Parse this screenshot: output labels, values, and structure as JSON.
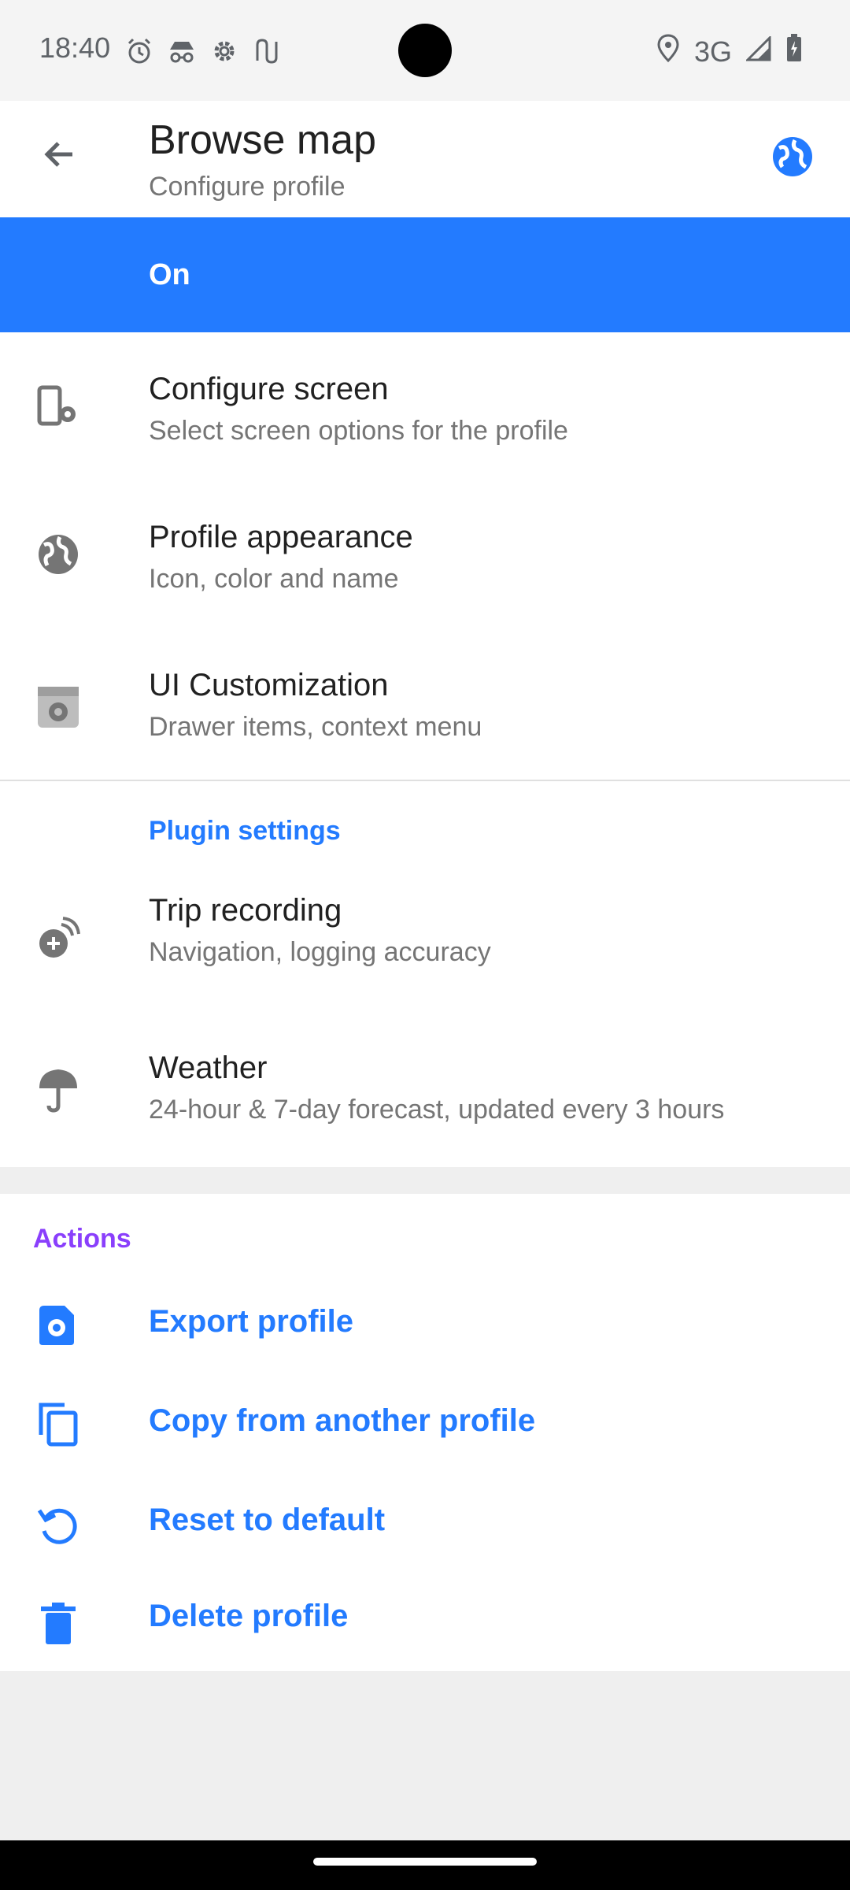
{
  "status_bar": {
    "time": "18:40",
    "icons_left": [
      "alarm-icon",
      "incognito-icon",
      "settings-gear-icon",
      "signal-monitor-icon"
    ],
    "network": "3G"
  },
  "app_bar": {
    "title": "Browse map",
    "subtitle": "Configure profile"
  },
  "profile_switch": {
    "label": "On",
    "accent": "#237bff"
  },
  "settings": [
    {
      "title": "Configure screen",
      "description": "Select screen options for the profile",
      "icon": "phone-settings-icon"
    },
    {
      "title": "Profile appearance",
      "description": "Icon, color and name",
      "icon": "globe-icon"
    },
    {
      "title": "UI Customization",
      "description": "Drawer items, context menu",
      "icon": "ui-customization-icon"
    }
  ],
  "plugin_section": {
    "header": "Plugin settings",
    "color": "#237bff",
    "items": [
      {
        "title": "Trip recording",
        "description": "Navigation, logging accuracy",
        "icon": "trip-recording-icon"
      },
      {
        "title": "Weather",
        "description": "24-hour & 7-day forecast, updated every 3 hours",
        "icon": "umbrella-icon"
      }
    ]
  },
  "actions_section": {
    "header": "Actions",
    "color": "#8a3ffc",
    "items": [
      {
        "label": "Export profile",
        "icon": "export-profile-icon"
      },
      {
        "label": "Copy from another profile",
        "icon": "copy-icon"
      },
      {
        "label": "Reset to default",
        "icon": "reset-icon"
      },
      {
        "label": "Delete profile",
        "icon": "delete-icon"
      }
    ]
  }
}
